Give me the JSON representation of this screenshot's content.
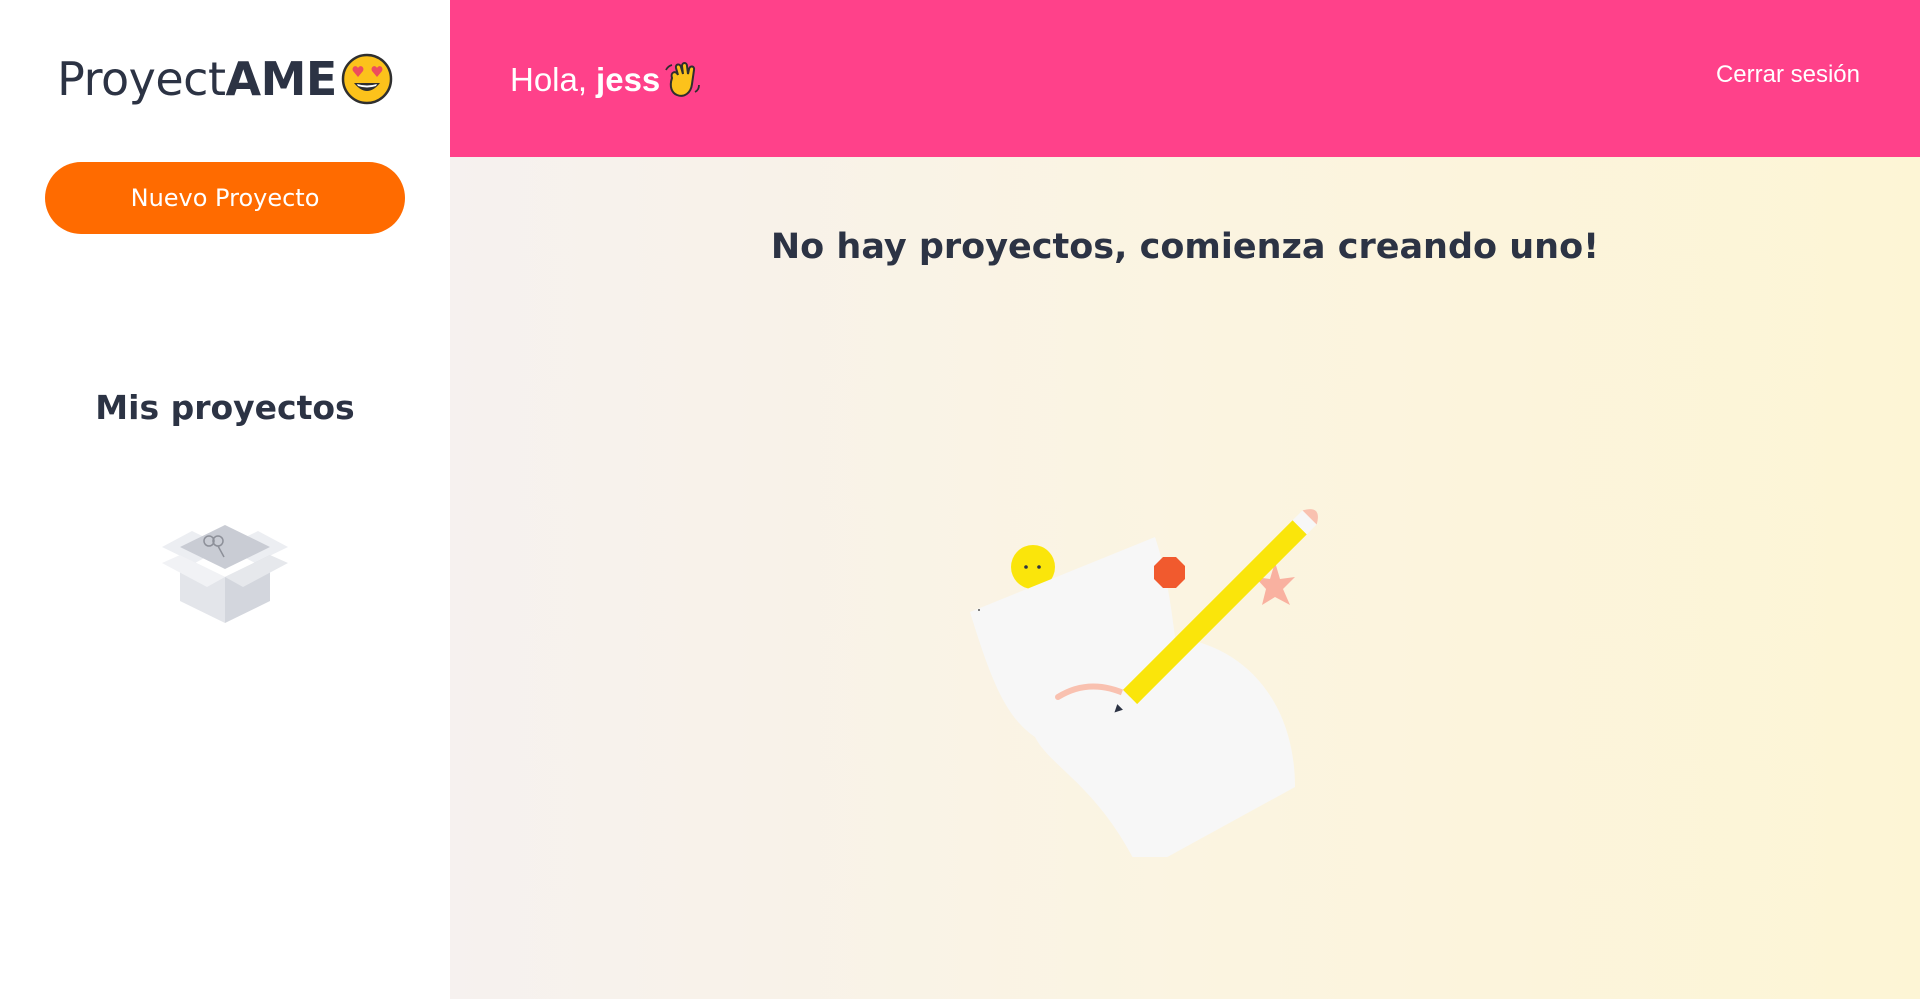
{
  "sidebar": {
    "logo": {
      "light_text": "Proyect",
      "bold_text": "AME",
      "emoji_icon": "heart-eyes-emoji-icon"
    },
    "new_project_label": "Nuevo Proyecto",
    "heading": "Mis proyectos",
    "empty_icon": "empty-box-icon"
  },
  "header": {
    "greeting_prefix": "Hola,",
    "username": "jess",
    "wave_icon": "waving-hand-icon",
    "logout_label": "Cerrar sesión"
  },
  "main": {
    "empty_message": "No hay proyectos, comienza creando uno!",
    "illustration_icon": "paper-and-pencil-illustration"
  },
  "colors": {
    "header_bg": "#ff418a",
    "button_bg": "#ff6b00",
    "text_dark": "#2c3344",
    "content_bg_left": "#f6f1ef",
    "content_bg_right": "#fdf5d5"
  }
}
